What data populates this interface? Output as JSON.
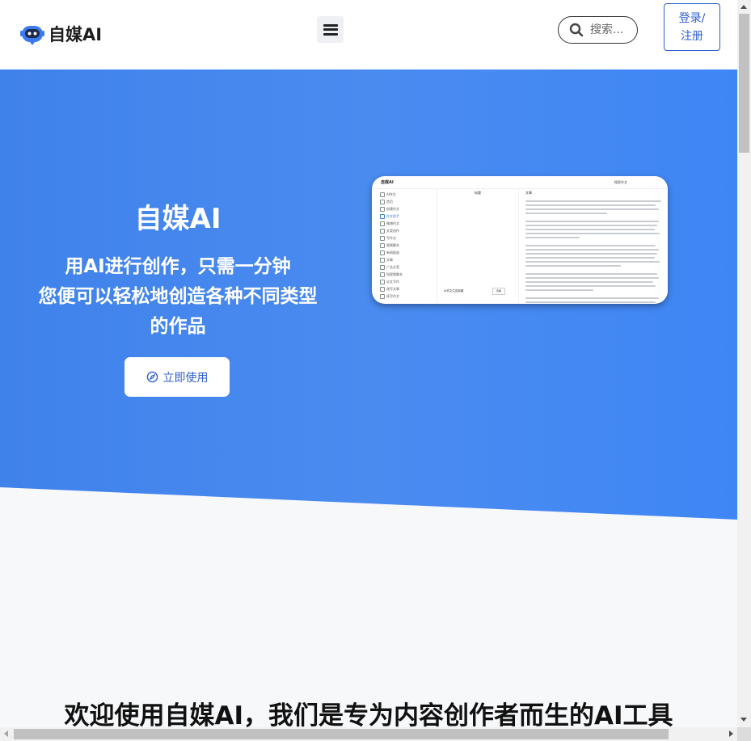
{
  "header": {
    "logo_text": "自媒AI",
    "logo_icon": "robot-head-icon",
    "menu_icon": "hamburger-menu-icon",
    "search": {
      "placeholder": "搜索...",
      "icon": "search-icon"
    },
    "login_label_line1": "登录/",
    "login_label_line2": "注册"
  },
  "hero": {
    "title": "自媒AI",
    "subtitle_line1": "用AI进行创作，只需一分钟",
    "subtitle_line2": "您便可以轻松地创造各种不同类型",
    "subtitle_line3": "的作品",
    "cta_label": "立即使用",
    "cta_icon": "compass-icon",
    "preview": {
      "logo": "自媒AI",
      "search_label": "搜索作文",
      "sidebar_items": [
        "AI作文",
        "首页",
        "创建作文",
        "作文助手",
        "微博作文",
        "文案创作",
        "写作文",
        "视频脚本",
        "新闻报道",
        "文章",
        "广告文案",
        "短视频脚本",
        "论文写作",
        "改写文章",
        "续写作文"
      ],
      "active_index": 3,
      "mid_header": "标题",
      "mid_row_text": "AI作文生成标题",
      "mid_row_button": "查看",
      "text_header": "文章"
    }
  },
  "welcome": {
    "heading": "欢迎使用自媒AI，我们是专为内容创作者而生的AI工具"
  },
  "colors": {
    "brand_blue": "#2f5fcf",
    "hero_blue": "#4a8bf0",
    "page_bg": "#f7f8fa"
  }
}
